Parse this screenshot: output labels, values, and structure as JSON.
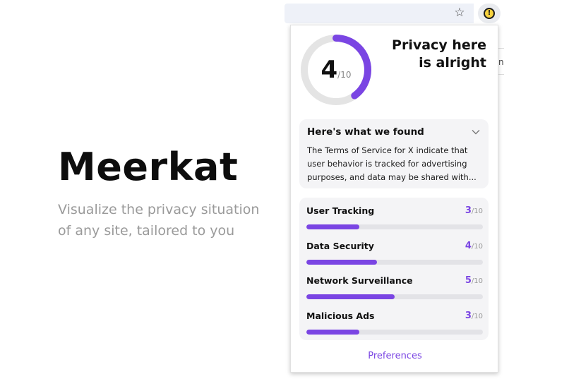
{
  "brand": {
    "title": "Meerkat",
    "tagline": "Visualize the privacy situation of any site, tailored to you"
  },
  "browser": {
    "star_icon": "star-outline-icon",
    "extension_icon": "warning-badge-icon",
    "bg_page_fragment": "nl"
  },
  "popup": {
    "score": "4",
    "score_max": "/10",
    "score_fraction": 0.4,
    "verdict": "Privacy here is alright",
    "found_title": "Here's what we found",
    "found_body": "The Terms of Service for X indicate that user behavior is tracked for advertising purposes, and data may be shared with...",
    "metrics": [
      {
        "label": "User Tracking",
        "score": "3",
        "max": "/10",
        "value": 3
      },
      {
        "label": "Data Security",
        "score": "4",
        "max": "/10",
        "value": 4
      },
      {
        "label": "Network Surveillance",
        "score": "5",
        "max": "/10",
        "value": 5
      },
      {
        "label": "Malicious Ads",
        "score": "3",
        "max": "/10",
        "value": 3
      }
    ],
    "preferences_label": "Preferences"
  },
  "colors": {
    "accent": "#7a45e3",
    "track": "#e3e3e7",
    "card": "#f4f4f6",
    "badge": "#f7d23e"
  }
}
